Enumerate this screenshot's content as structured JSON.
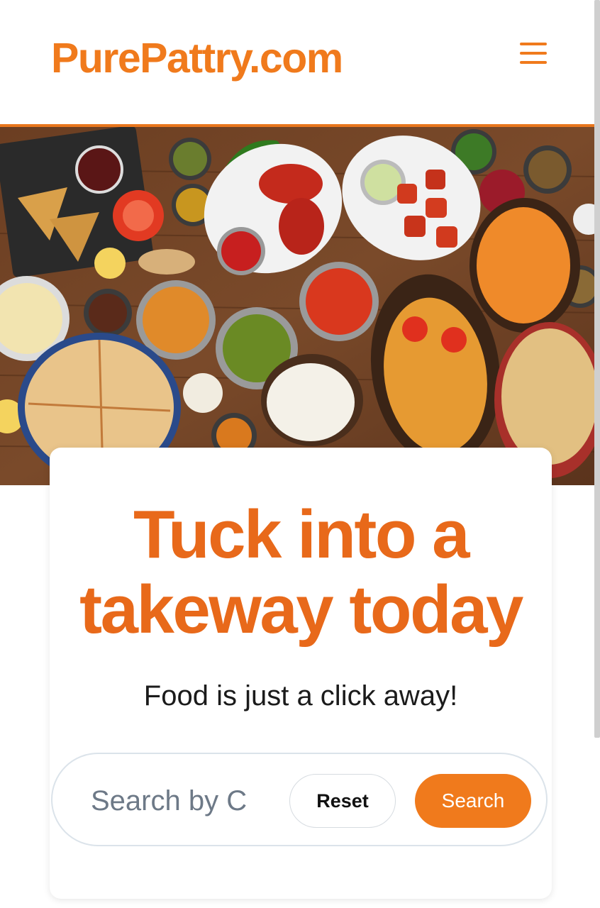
{
  "header": {
    "brand": "PurePattry.com",
    "menu_icon": "hamburger-menu-icon"
  },
  "hero": {
    "image_subject": "spread of Indian dishes on a wooden table"
  },
  "card": {
    "headline": "Tuck into a takeway today",
    "subline": "Food is just a click away!"
  },
  "search": {
    "placeholder": "Search by C",
    "value": "",
    "reset_label": "Reset",
    "search_label": "Search"
  },
  "colors": {
    "brand": "#f07a1c",
    "headline": "#e8691a",
    "search_button": "#f07a1c",
    "page_background": "#ffffff"
  }
}
